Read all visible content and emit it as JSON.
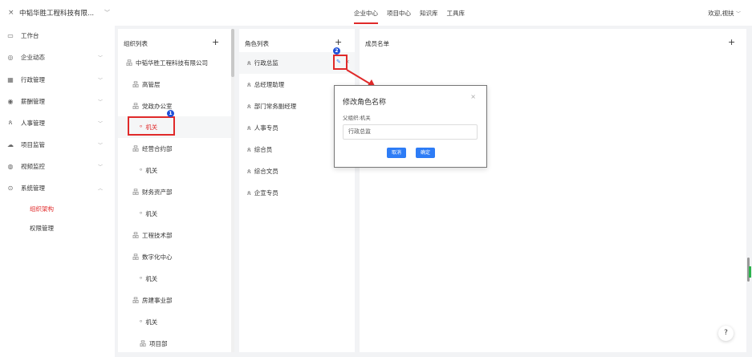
{
  "topbar": {
    "close_icon": "close-icon",
    "company": "中韬华胜工程科技有限...",
    "nav": [
      "企业中心",
      "项目中心",
      "知识库",
      "工具库"
    ],
    "active_nav": "企业中心",
    "welcome": "欢迎,视扶"
  },
  "sidebar": {
    "items": [
      {
        "icon": "monitor-icon",
        "label": "工作台"
      },
      {
        "icon": "globe-icon",
        "label": "企业动态"
      },
      {
        "icon": "grid-icon",
        "label": "行政管理"
      },
      {
        "icon": "coin-icon",
        "label": "薪酬管理"
      },
      {
        "icon": "people-icon",
        "label": "人事管理"
      },
      {
        "icon": "cloud-icon",
        "label": "项目监管"
      },
      {
        "icon": "camera-icon",
        "label": "视频监控"
      },
      {
        "icon": "settings-icon",
        "label": "系统管理"
      }
    ],
    "sub_items": [
      "组织架构",
      "权限管理"
    ],
    "active_sub": "组织架构",
    "accent_color": "#e02a2a"
  },
  "org_panel": {
    "title": "组织列表",
    "add": "+",
    "rows": [
      "中韬华胜工程科技有限公司",
      "高管层",
      "党政办公室",
      "机关",
      "经营合约部",
      "机关",
      "财务资产部",
      "机关",
      "工程技术部",
      "数字化中心",
      "机关",
      "房建事业部",
      "机关",
      "项目部"
    ]
  },
  "role_panel": {
    "title": "角色列表",
    "add": "+",
    "rows": [
      "行政总监",
      "总经理助理",
      "部门常务副经理",
      "人事专员",
      "综合员",
      "综合文员",
      "企宣专员"
    ]
  },
  "member_panel": {
    "title": "成员名单",
    "add": "+"
  },
  "dialog": {
    "title": "修改角色名称",
    "close": "×",
    "label": "父组织:机关",
    "input_value": "行政总监",
    "cancel": "取消",
    "confirm": "确定"
  },
  "annotations": {
    "badge1": "1",
    "badge2": "2",
    "highlight_color": "#e02a2a",
    "badge_color": "#1e4fd8"
  },
  "help": "?"
}
